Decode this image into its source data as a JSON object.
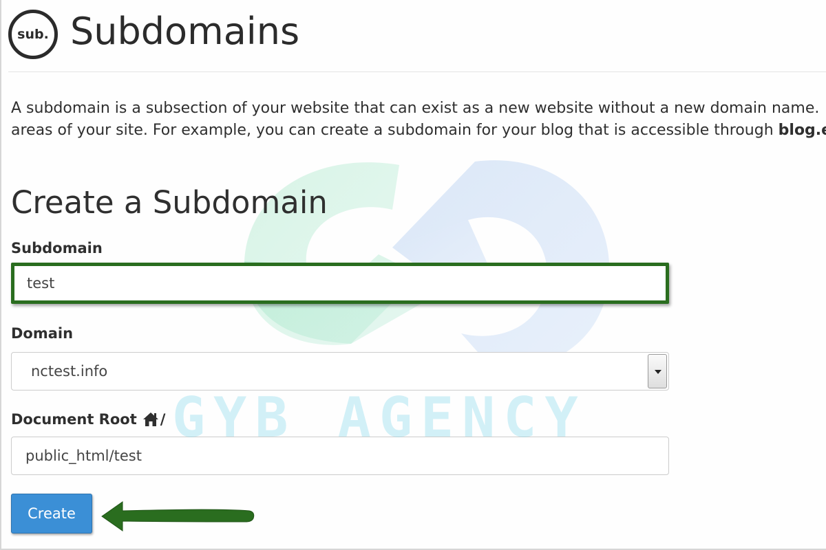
{
  "header": {
    "logo_text": "sub.",
    "title": "Subdomains"
  },
  "description": {
    "line1": "A subdomain is a subsection of your website that can exist as a new website without a new domain name.",
    "line2_prefix": "areas of your site. For example, you can create a subdomain for your blog that is accessible through ",
    "line2_bold": "blog.e"
  },
  "form": {
    "section_title": "Create a Subdomain",
    "subdomain_label": "Subdomain",
    "subdomain_value": "test",
    "domain_label": "Domain",
    "domain_selected": "nctest.info",
    "docroot_label": "Document Root",
    "docroot_slash": "/",
    "docroot_value": "public_html/test",
    "create_label": "Create"
  },
  "icons": {
    "logo": "sub-logo-icon",
    "home": "home-icon",
    "select_arrow": "chevron-down-icon",
    "annotation": "arrow-left-icon"
  },
  "watermark": {
    "text": "GYB AGENCY"
  },
  "colors": {
    "highlight_border": "#2a6d1f",
    "button_bg": "#3b8fd6",
    "annotation_arrow": "#2a6d1f"
  }
}
